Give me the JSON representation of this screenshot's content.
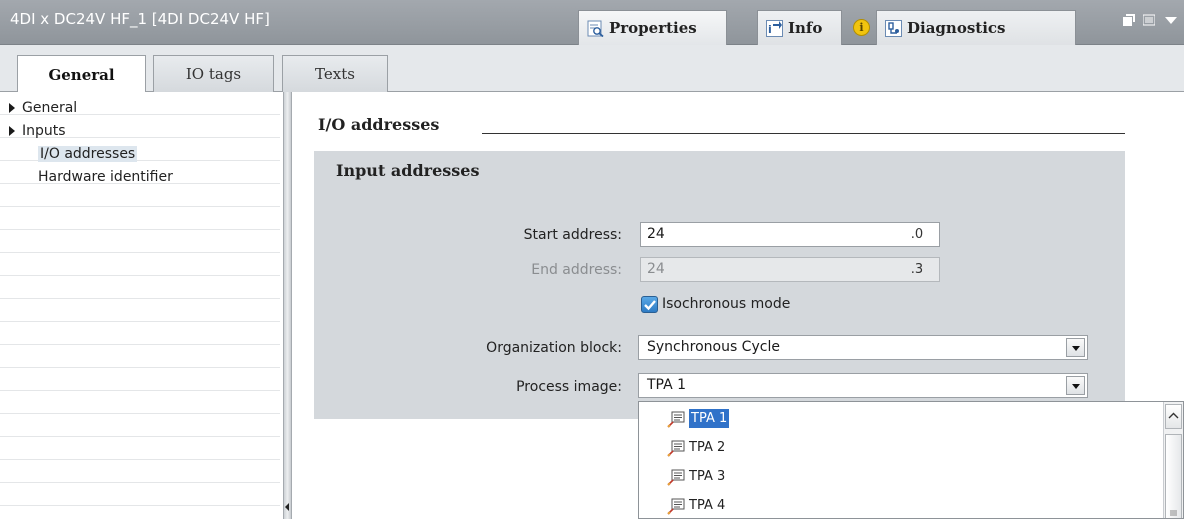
{
  "window": {
    "title": "4DI x DC24V HF_1 [4DI DC24V HF]"
  },
  "top_tabs": [
    {
      "label": "Properties",
      "icon": "properties-icon",
      "active": true
    },
    {
      "label": "Info",
      "icon": "info-icon",
      "active": false
    },
    {
      "label": "Diagnostics",
      "icon": "diagnostics-icon",
      "active": false
    }
  ],
  "sub_tabs": [
    {
      "label": "General",
      "active": true
    },
    {
      "label": "IO tags",
      "active": false
    },
    {
      "label": "Texts",
      "active": false
    }
  ],
  "nav": {
    "items": [
      {
        "label": "General",
        "expandable": true,
        "selected": false
      },
      {
        "label": "Inputs",
        "expandable": true,
        "selected": false
      },
      {
        "label": "I/O addresses",
        "expandable": false,
        "selected": true
      },
      {
        "label": "Hardware identifier",
        "expandable": false,
        "selected": false
      }
    ]
  },
  "section": {
    "title": "I/O addresses",
    "group_title": "Input addresses",
    "start_address": {
      "label": "Start address:",
      "value": "24",
      "bit": ".0"
    },
    "end_address": {
      "label": "End address:",
      "value": "24",
      "bit": ".3"
    },
    "isochronous": {
      "label": "Isochronous mode",
      "checked": true
    },
    "organization_block": {
      "label": "Organization block:",
      "value": "Synchronous Cycle"
    },
    "process_image": {
      "label": "Process image:",
      "value": "TPA 1"
    }
  },
  "dropdown": {
    "options": [
      "TPA 1",
      "TPA 2",
      "TPA 3",
      "TPA 4"
    ],
    "selected_index": 0
  },
  "colors": {
    "accent": "#3072c9",
    "titlebar": "#9ba0a6",
    "group_bg": "#d4d8dc",
    "info_badge": "#f1c40f"
  }
}
